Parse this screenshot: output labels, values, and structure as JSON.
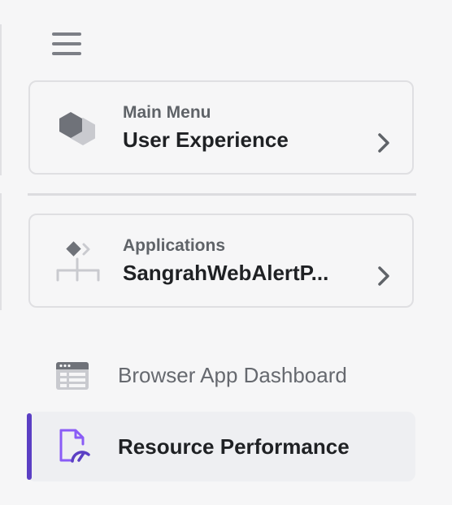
{
  "sidebar": {
    "menu_icon": "hamburger-menu-icon",
    "main_menu": {
      "label": "Main Menu",
      "value": "User Experience",
      "icon": "hexagon-stack-icon"
    },
    "applications": {
      "label": "Applications",
      "value": "SangrahWebAlertP...",
      "icon": "application-flow-icon"
    },
    "items": [
      {
        "label": "Browser App Dashboard",
        "icon": "browser-window-icon",
        "active": false
      },
      {
        "label": "Resource Performance",
        "icon": "file-gauge-icon",
        "active": true
      }
    ]
  },
  "colors": {
    "accent": "#5b3fc4",
    "resource_icon": "#8a5cf6",
    "active_background": "#eeeff2"
  }
}
